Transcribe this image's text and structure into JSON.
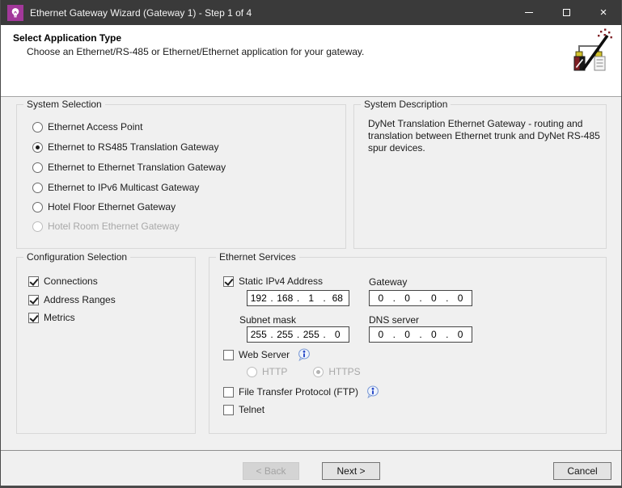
{
  "window": {
    "title": "Ethernet Gateway Wizard (Gateway 1) - Step 1 of 4",
    "controls": {
      "close_glyph": "×"
    }
  },
  "header": {
    "title": "Select Application Type",
    "subtitle": "Choose an Ethernet/RS-485 or Ethernet/Ethernet application for your gateway."
  },
  "system_selection": {
    "label": "System Selection",
    "options": [
      {
        "label": "Ethernet Access Point",
        "selected": false,
        "enabled": true
      },
      {
        "label": "Ethernet to RS485 Translation Gateway",
        "selected": true,
        "enabled": true
      },
      {
        "label": "Ethernet to Ethernet Translation Gateway",
        "selected": false,
        "enabled": true
      },
      {
        "label": "Ethernet to IPv6 Multicast Gateway",
        "selected": false,
        "enabled": true
      },
      {
        "label": "Hotel Floor Ethernet Gateway",
        "selected": false,
        "enabled": true
      },
      {
        "label": "Hotel Room Ethernet Gateway",
        "selected": false,
        "enabled": false
      }
    ]
  },
  "system_description": {
    "label": "System Description",
    "text": "DyNet Translation Ethernet Gateway - routing and translation between Ethernet trunk and DyNet RS-485 spur devices."
  },
  "configuration_selection": {
    "label": "Configuration Selection",
    "options": [
      {
        "label": "Connections",
        "checked": true
      },
      {
        "label": "Address Ranges",
        "checked": true
      },
      {
        "label": "Metrics",
        "checked": true
      }
    ]
  },
  "ethernet_services": {
    "label": "Ethernet Services",
    "dot": ".",
    "static_ipv4": {
      "label": "Static IPv4 Address",
      "checked": true,
      "octets": [
        "192",
        "168",
        "1",
        "68"
      ]
    },
    "gateway": {
      "label": "Gateway",
      "octets": [
        "0",
        "0",
        "0",
        "0"
      ]
    },
    "subnet_mask": {
      "label": "Subnet mask",
      "octets": [
        "255",
        "255",
        "255",
        "0"
      ]
    },
    "dns_server": {
      "label": "DNS server",
      "octets": [
        "0",
        "0",
        "0",
        "0"
      ]
    },
    "web_server": {
      "label": "Web Server",
      "checked": false
    },
    "protocol": {
      "http": {
        "label": "HTTP",
        "selected": false,
        "enabled": false
      },
      "https": {
        "label": "HTTPS",
        "selected": true,
        "enabled": false
      }
    },
    "ftp": {
      "label": "File Transfer Protocol (FTP)",
      "checked": false
    },
    "telnet": {
      "label": "Telnet",
      "checked": false
    }
  },
  "footer": {
    "back_label": "< Back",
    "back_enabled": false,
    "next_label": "Next >",
    "cancel_label": "Cancel"
  },
  "colors": {
    "titlebar_bg": "#3a3a3a",
    "app_icon_bg": "#a2389a",
    "header_bg": "#ffffff",
    "client_bg": "#f0f0f0",
    "info_icon_blue": "#2b4bc8",
    "window_border": "#4b4b4b"
  }
}
